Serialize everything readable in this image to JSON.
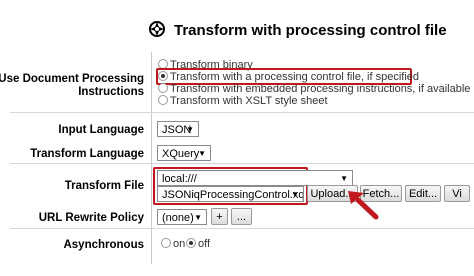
{
  "header": {
    "title": "Transform with processing control file",
    "icon": "gear-cog-icon"
  },
  "processing": {
    "label": "Use Document Processing Instructions",
    "options": [
      "Transform binary",
      "Transform with a processing control file, if specified",
      "Transform with embedded processing instructions, if available",
      "Transform with XSLT style sheet"
    ],
    "selected_index": 1
  },
  "input_language": {
    "label": "Input Language",
    "value": "JSON"
  },
  "transform_language": {
    "label": "Transform Language",
    "value": "XQuery"
  },
  "transform_file": {
    "label": "Transform File",
    "location": "local:///",
    "file": "JSONiqProcessingControl.xq",
    "buttons": [
      "Upload...",
      "Fetch...",
      "Edit...",
      "Vi"
    ]
  },
  "url_rewrite": {
    "label": "URL Rewrite Policy",
    "value": "(none)",
    "add": "+",
    "more": "..."
  },
  "asynchronous": {
    "label": "Asynchronous",
    "on": "on",
    "off": "off",
    "selected": "off"
  },
  "accent_color": "#c0181f"
}
